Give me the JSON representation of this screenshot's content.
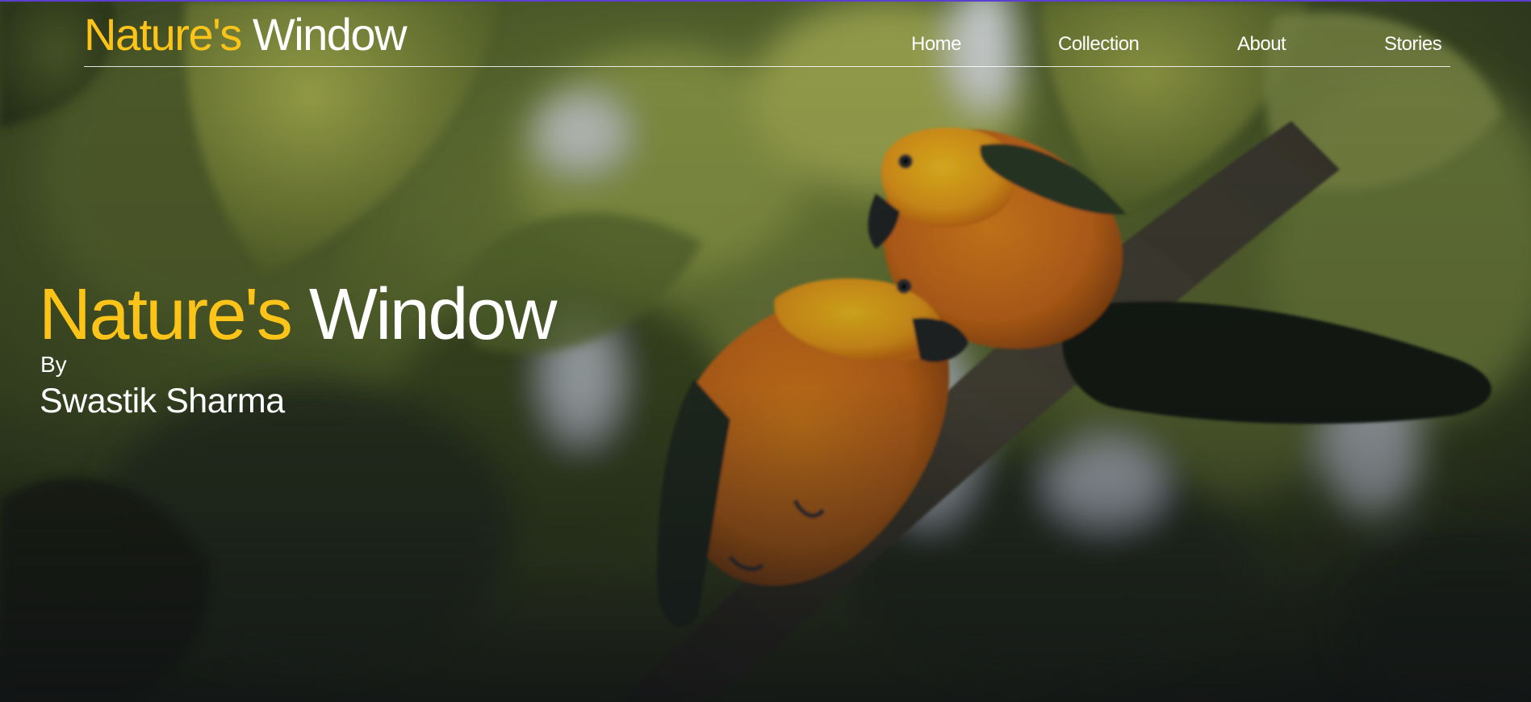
{
  "header": {
    "logo_part1": "Nature's",
    "logo_part2": "Window",
    "nav": {
      "home": "Home",
      "collection": "Collection",
      "about": "About",
      "stories": "Stories"
    }
  },
  "hero": {
    "title_part1": "Nature's",
    "title_part2": "Window",
    "by": "By",
    "author": "Swastik Sharma",
    "image_subject": "two orange-yellow parrots on a branch"
  },
  "colors": {
    "accent": "#fcc419",
    "text": "#ffffff",
    "top_border": "#5b3fd1"
  }
}
